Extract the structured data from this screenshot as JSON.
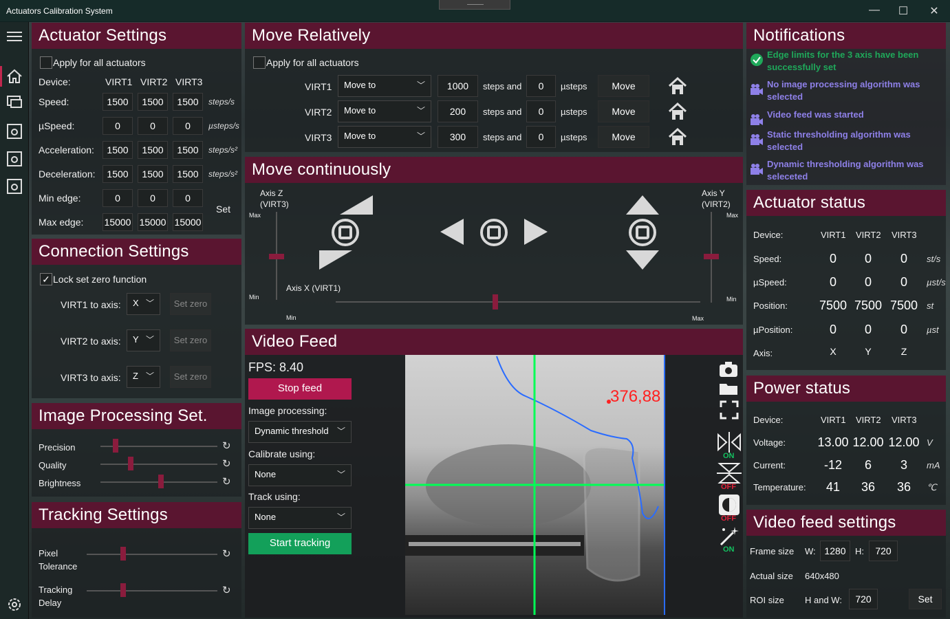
{
  "app_title": "Actuators Calibration System",
  "window_controls": {
    "minimize": "—",
    "maximize": "☐",
    "close": "✕"
  },
  "actuator_settings": {
    "title": "Actuator Settings",
    "apply_all": "Apply for all actuators",
    "device_label": "Device:",
    "devices": [
      "VIRT1",
      "VIRT2",
      "VIRT3"
    ],
    "rows": [
      {
        "label": "Speed:",
        "values": [
          "1500",
          "1500",
          "1500"
        ],
        "unit": "steps/s"
      },
      {
        "label": "µSpeed:",
        "values": [
          "0",
          "0",
          "0"
        ],
        "unit": "µsteps/s"
      },
      {
        "label": "Acceleration:",
        "values": [
          "1500",
          "1500",
          "1500"
        ],
        "unit": "steps/s²"
      },
      {
        "label": "Deceleration:",
        "values": [
          "1500",
          "1500",
          "1500"
        ],
        "unit": "steps/s²"
      },
      {
        "label": "Min edge:",
        "values": [
          "0",
          "0",
          "0"
        ],
        "unit": ""
      },
      {
        "label": "Max edge:",
        "values": [
          "15000",
          "15000",
          "15000"
        ],
        "unit": ""
      }
    ],
    "set_label": "Set"
  },
  "connection_settings": {
    "title": "Connection Settings",
    "lock_label": "Lock set zero function",
    "lock_checked": "✓",
    "rows": [
      {
        "label": "VIRT1 to axis:",
        "axis": "X",
        "button": "Set zero"
      },
      {
        "label": "VIRT2 to axis:",
        "axis": "Y",
        "button": "Set zero"
      },
      {
        "label": "VIRT3 to axis:",
        "axis": "Z",
        "button": "Set zero"
      }
    ]
  },
  "image_processing": {
    "title": "Image Processing Set.",
    "sliders": [
      {
        "label": "Precision",
        "level": 0.13
      },
      {
        "label": "Quality",
        "level": 0.26
      },
      {
        "label": "Brightness",
        "level": 0.52
      }
    ]
  },
  "tracking_settings": {
    "title": "Tracking Settings",
    "sliders": [
      {
        "label": "Pixel\nTolerance",
        "level": 0.28
      },
      {
        "label": "Tracking\nDelay",
        "level": 0.28
      }
    ]
  },
  "move_relatively": {
    "title": "Move Relatively",
    "apply_all": "Apply for all actuators",
    "rows": [
      {
        "device": "VIRT1",
        "mode": "Move to",
        "steps": "1000",
        "steps_label": "steps and",
        "usteps": "0",
        "usteps_label": "µsteps",
        "button": "Move"
      },
      {
        "device": "VIRT2",
        "mode": "Move to",
        "steps": "200",
        "steps_label": "steps and",
        "usteps": "0",
        "usteps_label": "µsteps",
        "button": "Move"
      },
      {
        "device": "VIRT3",
        "mode": "Move to",
        "steps": "300",
        "steps_label": "steps and",
        "usteps": "0",
        "usteps_label": "µsteps",
        "button": "Move"
      }
    ]
  },
  "move_continuously": {
    "title": "Move continuously",
    "axis_z": "Axis Z\n(VIRT3)",
    "axis_y": "Axis Y\n(VIRT2)",
    "axis_x": "Axis X (VIRT1)",
    "max": "Max",
    "min": "Min"
  },
  "video_feed": {
    "title": "Video Feed",
    "fps": "FPS: 8.40",
    "stop_feed": "Stop feed",
    "image_processing_label": "Image processing:",
    "image_processing_value": "Dynamic threshold",
    "calibrate_label": "Calibrate using:",
    "calibrate_value": "None",
    "track_label": "Track using:",
    "track_value": "None",
    "start_tracking": "Start tracking",
    "overlay_text": "376,88",
    "toggle_states": [
      "ON",
      "OFF",
      "OFF",
      "ON"
    ]
  },
  "notifications": {
    "title": "Notifications",
    "items": [
      {
        "text": "Edge limits for the 3 axis have been successfully set",
        "icon": "check-circle-icon",
        "color": "#1fa85a"
      },
      {
        "text": "No image processing algorithm was selected",
        "icon": "camera-icon",
        "color": "#8e80e8"
      },
      {
        "text": "Video feed was started",
        "icon": "camera-icon",
        "color": "#8e80e8"
      },
      {
        "text": "Static thresholding algorithm was selected",
        "icon": "camera-icon",
        "color": "#8e80e8"
      },
      {
        "text": "Dynamic thresholding algorithm was seleceted",
        "icon": "camera-icon",
        "color": "#8e80e8"
      }
    ]
  },
  "actuator_status": {
    "title": "Actuator status",
    "device_label": "Device:",
    "devices": [
      "VIRT1",
      "VIRT2",
      "VIRT3"
    ],
    "rows": [
      {
        "label": "Speed:",
        "values": [
          "0",
          "0",
          "0"
        ],
        "unit": "st/s"
      },
      {
        "label": "µSpeed:",
        "values": [
          "0",
          "0",
          "0"
        ],
        "unit": "µst/s"
      },
      {
        "label": "Position:",
        "values": [
          "7500",
          "7500",
          "7500"
        ],
        "unit": "st"
      },
      {
        "label": "µPosition:",
        "values": [
          "0",
          "0",
          "0"
        ],
        "unit": "µst"
      },
      {
        "label": "Axis:",
        "values": [
          "X",
          "Y",
          "Z"
        ],
        "unit": ""
      }
    ]
  },
  "power_status": {
    "title": "Power status",
    "device_label": "Device:",
    "devices": [
      "VIRT1",
      "VIRT2",
      "VIRT3"
    ],
    "rows": [
      {
        "label": "Voltage:",
        "values": [
          "13.00",
          "12.00",
          "12.00"
        ],
        "unit": "V"
      },
      {
        "label": "Current:",
        "values": [
          "-12",
          "6",
          "3"
        ],
        "unit": "mA"
      },
      {
        "label": "Temperature:",
        "values": [
          "41",
          "36",
          "36"
        ],
        "unit": "℃"
      }
    ]
  },
  "video_feed_settings": {
    "title": "Video feed settings",
    "frame_size_label": "Frame size",
    "w_label": "W:",
    "w_value": "1280",
    "h_label": "H:",
    "h_value": "720",
    "actual_size_label": "Actual size",
    "actual_size_value": "640x480",
    "roi_label": "ROI size",
    "roi_hw_label": "H and W:",
    "roi_value": "720",
    "set_label": "Set"
  },
  "colors": {
    "header": "#5a1530",
    "accent": "#8a1c3d",
    "stop_feed": "#b0184e",
    "start_tracking": "#13a05a",
    "notification": "#8e80e8",
    "track_overlay": "#00ff55"
  }
}
